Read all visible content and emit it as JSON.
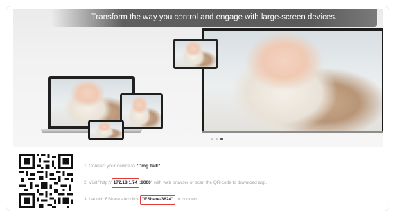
{
  "banner": {
    "title": "Transform the way you control and engage with large-screen devices.",
    "carousel_dots": 3,
    "carousel_active_index": 2
  },
  "instructions": {
    "step1": {
      "prefix": "1. Connect your device to ",
      "network": "\"Ding Talk\""
    },
    "step2": {
      "prefix": "2. Visit \"http://",
      "ip": "172.18.1.74",
      "port": ":8000",
      "suffix": "\" with web browser or scan the QR-code to download app."
    },
    "step3": {
      "prefix": "3. Launch EShare and click ",
      "device": "\"EShare-3624\"",
      "suffix": " to connect."
    }
  },
  "colors": {
    "highlight_border": "#e23d3d",
    "step_text": "#a5a5a5",
    "banner_title_bg": "#5f5f5f"
  },
  "icons": {
    "qr": "qr-code-icon"
  }
}
